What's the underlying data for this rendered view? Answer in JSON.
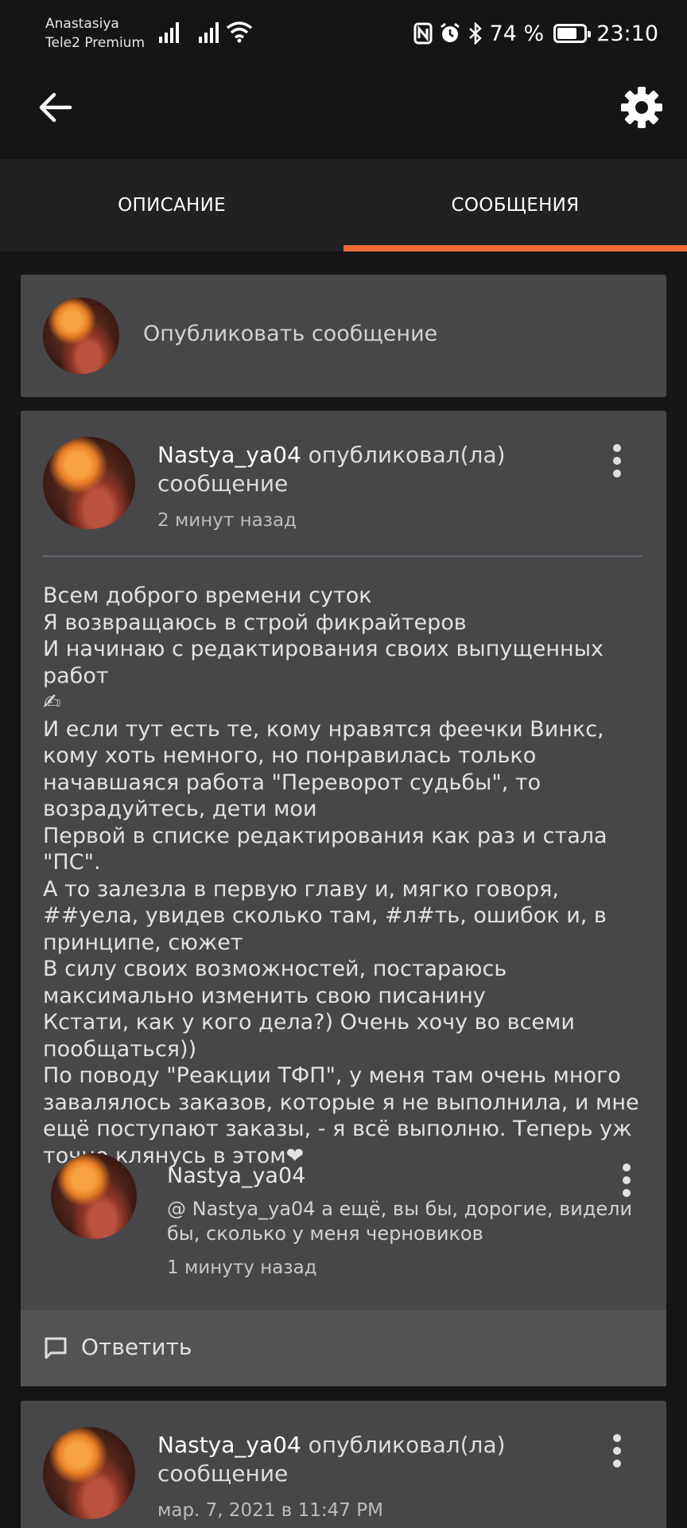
{
  "status_bar": {
    "carrier_name": "Anastasiya",
    "carrier_plan": "Tele2 Premium",
    "battery_percent": "74 %",
    "battery_level": 0.74,
    "time": "23:10",
    "icons": [
      "signal-icon",
      "signal-icon",
      "wifi-icon",
      "nfc-icon",
      "alarm-icon",
      "bluetooth-icon",
      "battery-icon"
    ]
  },
  "appbar": {
    "back_icon": "arrow-left-icon",
    "settings_icon": "gear-icon"
  },
  "tabs": [
    {
      "label": "ОПИСАНИЕ",
      "active": false
    },
    {
      "label": "СООБЩЕНИЯ",
      "active": true
    }
  ],
  "accent_color": "#ec6b35",
  "compose": {
    "placeholder": "Опубликовать сообщение"
  },
  "posts": [
    {
      "username": "Nastya_ya04",
      "action": " опубликовал(ла) сообщение",
      "time": "2 минут назад",
      "body": "Всем доброго времени суток\nЯ возвращаюсь в строй фикрайтеров\nИ начинаю с редактирования своих выпущенных работ\n✍\nИ если тут есть те, кому нравятся феечки Винкс, кому хоть немного, но понравилась только начавшаяся работа \"Переворот судьбы\", то возрадуйтесь, дети мои\nПервой в списке редактирования как раз и стала \"ПС\".\nА то залезла в первую главу и, мягко говоря, ##уела, увидев сколько там, #л#ть, ошибок и, в принципе, сюжет\nВ силу своих возможностей, постараюсь максимально изменить свою писанину\nКстати, как у кого дела?) Очень хочу во всеми пообщаться))\nПо поводу \"Реакции ТФП\", у меня там очень много завалялось заказов, которые я не выполнила, и мне ещё поступают заказы, - я всё выполню. Теперь уж точно клянусь в этом❤",
      "comment": {
        "username": "Nastya_ya04",
        "text": "@ Nastya_ya04  а ещё, вы бы, дорогие, видели бы, сколько у меня черновиков",
        "time": "1 минуту назад"
      },
      "reply_label": "Ответить"
    },
    {
      "username": "Nastya_ya04",
      "action": " опубликовал(ла) сообщение",
      "time": "мар. 7, 2021 в 11:47 PM"
    }
  ]
}
